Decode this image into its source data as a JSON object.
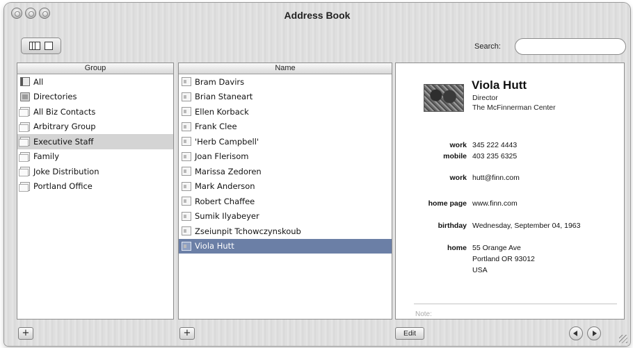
{
  "window": {
    "title": "Address Book"
  },
  "toolbar": {
    "view_toggle_icons": [
      "card-and-column-view-icon",
      "card-only-view-icon"
    ],
    "search_label": "Search:",
    "search_value": ""
  },
  "group_pane": {
    "header": "Group",
    "selected_index": 4,
    "items": [
      {
        "label": "All",
        "icon": "all-contacts-icon"
      },
      {
        "label": "Directories",
        "icon": "directory-icon"
      },
      {
        "label": "All Biz Contacts",
        "icon": "group-icon"
      },
      {
        "label": "Arbitrary Group",
        "icon": "group-icon"
      },
      {
        "label": "Executive Staff",
        "icon": "group-icon"
      },
      {
        "label": "Family",
        "icon": "group-icon"
      },
      {
        "label": "Joke Distribution",
        "icon": "group-icon"
      },
      {
        "label": "Portland Office",
        "icon": "group-icon"
      }
    ]
  },
  "name_pane": {
    "header": "Name",
    "selected_index": 11,
    "items": [
      "Bram Davirs",
      "Brian Staneart",
      "Ellen Korback",
      "Frank Clee",
      "'Herb Campbell'",
      "Joan Flerisom",
      "Marissa Zedoren",
      "Mark Anderson",
      "Robert Chaffee",
      "Sumik Ilyabeyer",
      "Zseiunpit Tchowczynskoub",
      "Viola Hutt"
    ]
  },
  "card": {
    "name": "Viola Hutt",
    "title": "Director",
    "company": "The McFinnerman Center",
    "phones": [
      {
        "label": "work",
        "value": "345 222 4443"
      },
      {
        "label": "mobile",
        "value": "403 235 6325"
      }
    ],
    "email": {
      "label": "work",
      "value": "hutt@finn.com"
    },
    "homepage": {
      "label": "home page",
      "value": "www.finn.com"
    },
    "birthday": {
      "label": "birthday",
      "value": "Wednesday, September 04, 1963"
    },
    "address": {
      "label": "home",
      "line1": "55 Orange Ave",
      "line2": "Portland OR 93012",
      "line3": "USA"
    },
    "note_label": "Note:"
  },
  "bottom_bar": {
    "add_group_label": "+",
    "add_name_label": "+",
    "edit_label": "Edit"
  },
  "colors": {
    "selection_blue": "#6b7fa6",
    "selection_gray": "#d4d4d4"
  }
}
